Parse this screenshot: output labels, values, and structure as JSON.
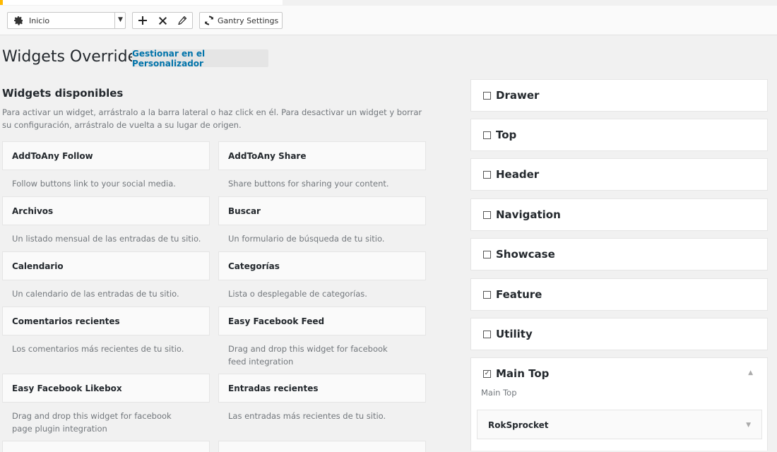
{
  "toolbar": {
    "select_value": "Inicio",
    "gantry_label": "Gantry Settings"
  },
  "page": {
    "title": "Widgets Override",
    "customizer_link": "Gestionar en el Personalizador"
  },
  "available": {
    "title": "Widgets disponibles",
    "description": "Para activar un widget, arrástralo a la barra lateral o haz click en él. Para desactivar un widget y borrar su configuración, arrástralo de vuelta a su lugar de origen.",
    "widgets": [
      {
        "title": "AddToAny Follow",
        "desc": "Follow buttons link to your social media."
      },
      {
        "title": "AddToAny Share",
        "desc": "Share buttons for sharing your content."
      },
      {
        "title": "Archivos",
        "desc": "Un listado mensual de las entradas de tu sitio."
      },
      {
        "title": "Buscar",
        "desc": "Un formulario de búsqueda de tu sitio."
      },
      {
        "title": "Calendario",
        "desc": "Un calendario de las entradas de tu sitio."
      },
      {
        "title": "Categorías",
        "desc": "Lista o desplegable de categorías."
      },
      {
        "title": "Comentarios recientes",
        "desc": "Los comentarios más recientes de tu sitio."
      },
      {
        "title": "Easy Facebook Feed",
        "desc": "Drag and drop this widget for facebook feed integration"
      },
      {
        "title": "Easy Facebook Likebox",
        "desc": "Drag and drop this widget for facebook page plugin integration"
      },
      {
        "title": "Entradas recientes",
        "desc": "Las entradas más recientes de tu sitio."
      }
    ]
  },
  "sidebars": [
    {
      "name": "Drawer"
    },
    {
      "name": "Top"
    },
    {
      "name": "Header"
    },
    {
      "name": "Navigation"
    },
    {
      "name": "Showcase"
    },
    {
      "name": "Feature"
    },
    {
      "name": "Utility"
    },
    {
      "name": "Main Top",
      "description": "Main Top",
      "widgets": [
        {
          "title": "RokSprocket"
        }
      ]
    }
  ]
}
